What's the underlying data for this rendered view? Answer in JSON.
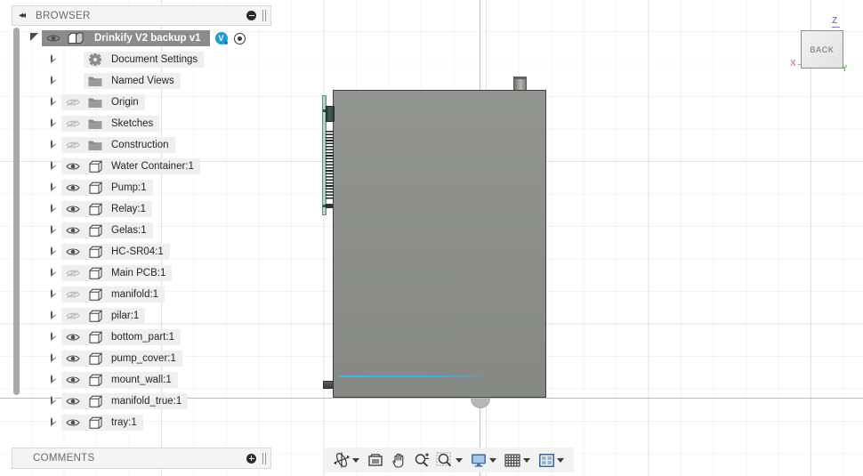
{
  "app": {
    "viewcube": {
      "face_label": "BACK",
      "axis_z": "Z",
      "axis_x": "X",
      "axis_y": "Y",
      "axis_z_color": "#7b7bdd",
      "axis_x_color": "#e08b8b",
      "axis_y_color": "#63c163"
    }
  },
  "browser": {
    "title": "BROWSER",
    "collapse_icon": "◂◂",
    "collapse_glyph": "collapse-left-icon",
    "minimize_icon": "minus-circle-icon",
    "grip_icon": "drag-grip-icon",
    "root": {
      "label": "Drinkify V2 backup v1",
      "expanded": true,
      "visible": true,
      "badge": "V",
      "badge_color": "#1a9ed9",
      "target_icon": "target-dot-icon",
      "component_icon": "component-icon"
    },
    "items": [
      {
        "label": "Document Settings",
        "icon": "gear-icon",
        "visible": null,
        "expandable": true
      },
      {
        "label": "Named Views",
        "icon": "folder-icon",
        "visible": null,
        "expandable": true
      },
      {
        "label": "Origin",
        "icon": "folder-icon",
        "visible": false,
        "expandable": true
      },
      {
        "label": "Sketches",
        "icon": "folder-icon",
        "visible": false,
        "expandable": true
      },
      {
        "label": "Construction",
        "icon": "folder-icon",
        "visible": false,
        "expandable": true
      },
      {
        "label": "Water Container:1",
        "icon": "body-icon",
        "visible": true,
        "expandable": true
      },
      {
        "label": "Pump:1",
        "icon": "body-icon",
        "visible": true,
        "expandable": true
      },
      {
        "label": "Relay:1",
        "icon": "body-icon",
        "visible": true,
        "expandable": true
      },
      {
        "label": "Gelas:1",
        "icon": "body-icon",
        "visible": true,
        "expandable": true
      },
      {
        "label": "HC-SR04:1",
        "icon": "body-icon",
        "visible": true,
        "expandable": true
      },
      {
        "label": "Main PCB:1",
        "icon": "body-icon",
        "visible": false,
        "expandable": true
      },
      {
        "label": "manifold:1",
        "icon": "body-icon",
        "visible": false,
        "expandable": true
      },
      {
        "label": "pilar:1",
        "icon": "body-icon",
        "visible": false,
        "expandable": true
      },
      {
        "label": "bottom_part:1",
        "icon": "body-icon",
        "visible": true,
        "expandable": true
      },
      {
        "label": "pump_cover:1",
        "icon": "body-icon",
        "visible": true,
        "expandable": true
      },
      {
        "label": "mount_wall:1",
        "icon": "body-icon",
        "visible": true,
        "expandable": true
      },
      {
        "label": "manifold_true:1",
        "icon": "body-icon",
        "visible": true,
        "expandable": true
      },
      {
        "label": "tray:1",
        "icon": "body-icon",
        "visible": true,
        "expandable": true
      }
    ]
  },
  "comments": {
    "title": "COMMENTS",
    "add_icon": "plus-circle-icon",
    "grip_icon": "drag-grip-icon"
  },
  "navbar": {
    "items": [
      {
        "name": "orbit-icon",
        "has_caret": true
      },
      {
        "name": "look-at-icon",
        "has_caret": false
      },
      {
        "name": "pan-hand-icon",
        "has_caret": false
      },
      {
        "name": "zoom-magnifier-icon",
        "has_caret": false
      },
      {
        "name": "zoom-window-icon",
        "has_caret": true
      },
      {
        "name": "display-settings-icon",
        "has_caret": true
      },
      {
        "name": "grid-snaps-icon",
        "has_caret": true
      },
      {
        "name": "viewports-icon",
        "has_caret": true
      }
    ]
  },
  "canvas": {
    "axis_x_color": "#f1a3a8",
    "axis_z_color": "#b4b6f0",
    "background": "#ffffff",
    "model": {
      "body_color": "#8b8e89",
      "edge_color": "#3f4245",
      "highlight_edge_color": "#38b0e6",
      "pcb_color": "#a7c9c4"
    }
  }
}
